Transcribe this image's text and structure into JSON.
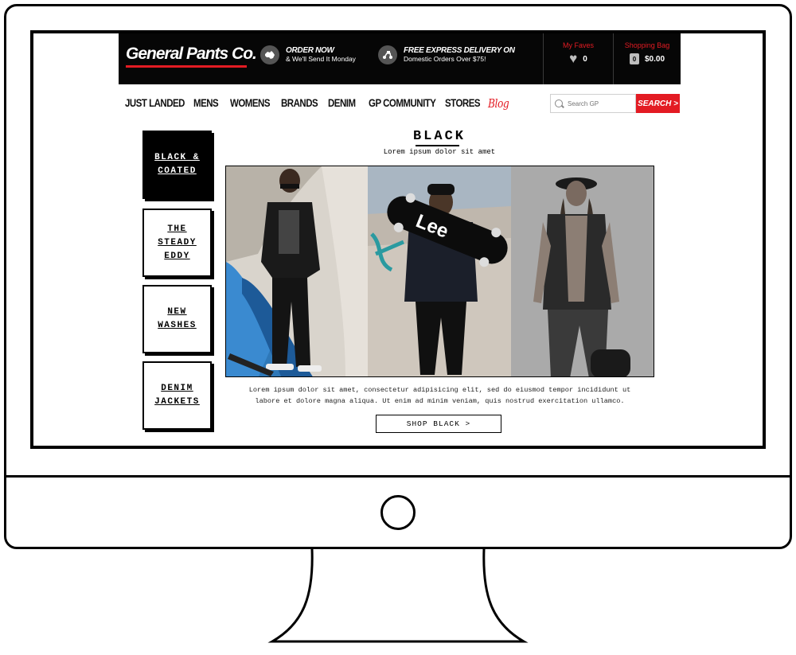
{
  "header": {
    "logo_text": "General Pants Co.",
    "promo_order": {
      "title": "ORDER NOW",
      "subtitle": "& We'll Send It Monday",
      "icon": "australia-map-icon"
    },
    "promo_delivery": {
      "title": "FREE EXPRESS DELIVERY ON",
      "subtitle": "Domestic Orders Over $75!",
      "icon": "delivery-scooter-icon"
    },
    "faves": {
      "label": "My Faves",
      "count": "0",
      "icon": "heart-icon"
    },
    "bag": {
      "label": "Shopping Bag",
      "count": "0",
      "total": "$0.00",
      "icon": "shopping-bag-icon"
    }
  },
  "nav": {
    "items": [
      "JUST LANDED",
      "MENS",
      "WOMENS",
      "BRANDS",
      "DENIM",
      "GP COMMUNITY",
      "STORES"
    ],
    "blog": "Blog"
  },
  "search": {
    "placeholder": "Search GP",
    "button": "SEARCH >"
  },
  "sidebar": {
    "tiles": [
      {
        "label": "BLACK &\nCOATED",
        "active": true
      },
      {
        "label": "THE\nSTEADY\nEDDY",
        "active": false
      },
      {
        "label": "NEW\nWASHES",
        "active": false
      },
      {
        "label": "DENIM\nJACKETS",
        "active": false
      }
    ]
  },
  "main": {
    "title": "BLACK",
    "subtitle": "Lorem ipsum dolor sit amet",
    "skateboard_text": "Lee",
    "body_line1": "Lorem ipsum dolor sit amet, consectetur adipisicing elit, sed do eiusmod tempor incididunt ut",
    "body_line2": "labore et dolore magna aliqua. Ut enim ad minim veniam, quis nostrud exercitation ullamco.",
    "cta": "SHOP BLACK >"
  },
  "colors": {
    "brand_red": "#e31b23",
    "header_bg": "#060606",
    "ink": "#000000"
  }
}
